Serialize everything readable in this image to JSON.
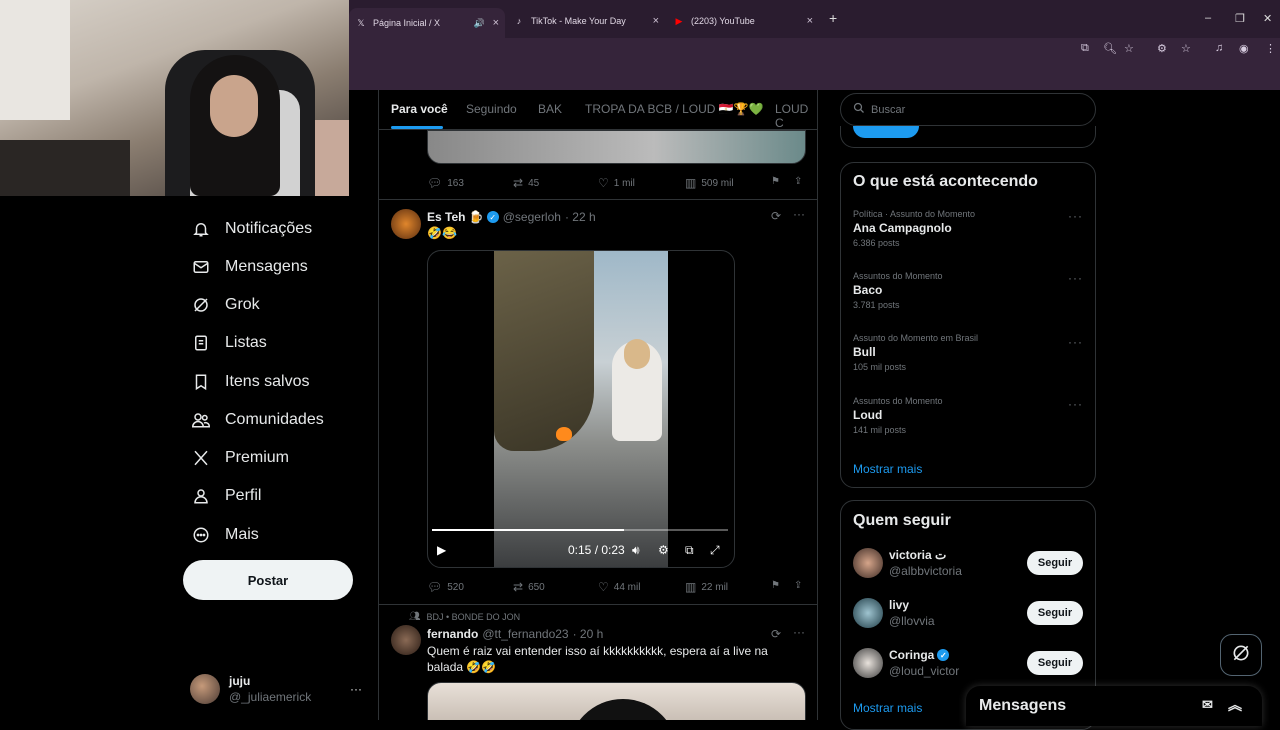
{
  "browser": {
    "tabs": [
      {
        "title": "Página Inicial / X",
        "icon": "x-logo-icon",
        "active": true
      },
      {
        "title": "TikTok - Make Your Day",
        "icon": "tiktok-icon",
        "active": false
      },
      {
        "title": "(2203) YouTube",
        "icon": "youtube-icon",
        "active": false
      }
    ],
    "new_tab": "+",
    "window_controls": [
      "–",
      "❐",
      "✕"
    ]
  },
  "nav": {
    "items": [
      {
        "label": "Notificações",
        "icon": "bell-icon"
      },
      {
        "label": "Mensagens",
        "icon": "envelope-icon"
      },
      {
        "label": "Grok",
        "icon": "grok-icon"
      },
      {
        "label": "Listas",
        "icon": "list-icon"
      },
      {
        "label": "Itens salvos",
        "icon": "bookmark-icon"
      },
      {
        "label": "Comunidades",
        "icon": "people-icon"
      },
      {
        "label": "Premium",
        "icon": "x-logo-icon"
      },
      {
        "label": "Perfil",
        "icon": "person-icon"
      },
      {
        "label": "Mais",
        "icon": "more-circle-icon"
      }
    ],
    "post_button": "Postar",
    "account": {
      "name": "juju",
      "handle": "@_juliaemerick",
      "more": "···"
    }
  },
  "feed": {
    "tabs": [
      "Para você",
      "Seguindo",
      "BAK",
      "TROPA DA BCB / LOUD 🇪🇬🏆💚",
      "LOUD C"
    ],
    "post1_actions": {
      "replies": "163",
      "reposts": "45",
      "likes": "1 mil",
      "views": "509 mil"
    },
    "post2": {
      "name": "Es Teh 🍺",
      "handle": "@segerloh",
      "time": "· 22 h",
      "text": "🤣😂",
      "video_time": "0:15 / 0:23",
      "progress": 0.65,
      "replies": "520",
      "reposts": "650",
      "likes": "44 mil",
      "views": "22 mil"
    },
    "post3": {
      "community": "BDJ • BONDE DO JON",
      "name": "fernando",
      "handle": "@tt_fernando23",
      "time": "· 20 h",
      "text": "Quem é raiz vai entender isso aí kkkkkkkkkk, espera aí a live na balada 🤣🤣"
    }
  },
  "sidebar": {
    "search_placeholder": "Buscar",
    "trends_title": "O que está acontecendo",
    "trends": [
      {
        "category": "Política · Assunto do Momento",
        "title": "Ana Campagnolo",
        "count": "6.386 posts"
      },
      {
        "category": "Assuntos do Momento",
        "title": "Baco",
        "count": "3.781 posts"
      },
      {
        "category": "Assunto do Momento em Brasil",
        "title": "Bull",
        "count": "105 mil posts"
      },
      {
        "category": "Assuntos do Momento",
        "title": "Loud",
        "count": "141 mil posts"
      }
    ],
    "show_more": "Mostrar mais",
    "who_title": "Quem seguir",
    "who": [
      {
        "name": "victoria ت",
        "handle": "@albbvictoria",
        "verified": false
      },
      {
        "name": "livy",
        "handle": "@llovvia",
        "verified": false
      },
      {
        "name": "Coringa",
        "handle": "@loud_victor",
        "verified": true
      }
    ],
    "follow_label": "Seguir",
    "who_more": "Mostrar mais"
  },
  "messages": {
    "title": "Mensagens"
  },
  "colors": {
    "accent": "#1d9bf0",
    "bg": "#000000",
    "muted": "#71767b",
    "browser": "#35243a"
  }
}
